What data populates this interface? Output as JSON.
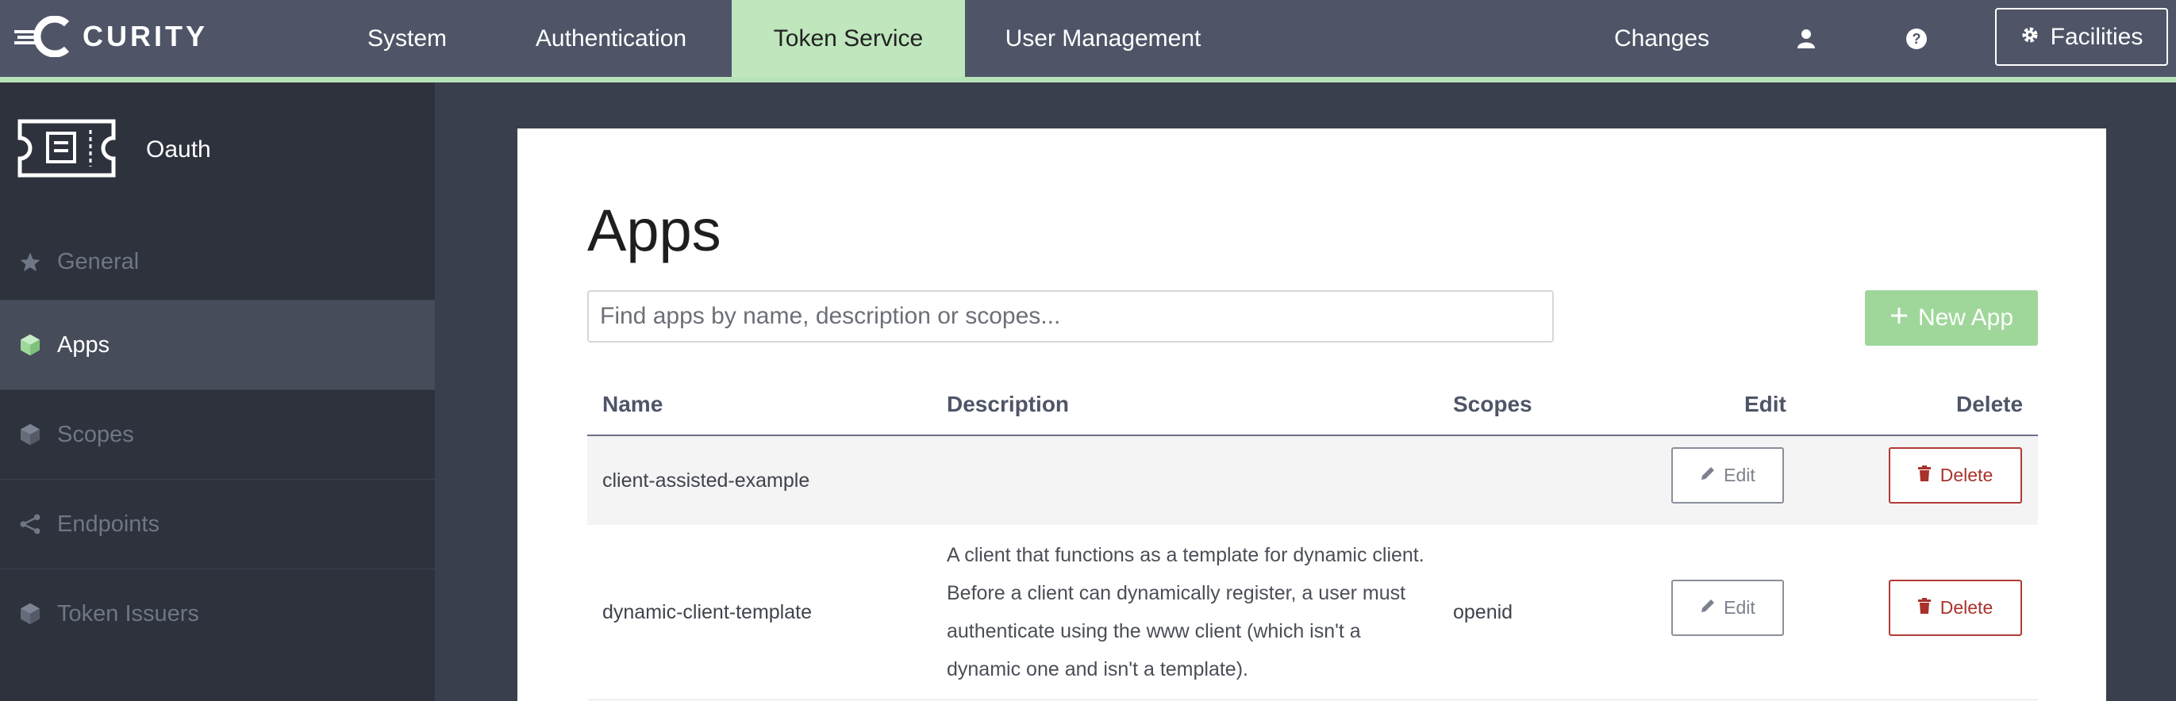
{
  "brand": {
    "name": "CURITY"
  },
  "nav": {
    "items": [
      {
        "label": "System"
      },
      {
        "label": "Authentication"
      },
      {
        "label": "Token Service"
      },
      {
        "label": "User Management"
      }
    ],
    "active": "Token Service",
    "changes_label": "Changes",
    "user_icon": "user-icon",
    "help_icon": "help-icon",
    "facilities_label": "Facilities",
    "facilities_icon": "gear-icon"
  },
  "sidebar": {
    "title": "Oauth",
    "header_icon": "ticket-icon",
    "items": [
      {
        "label": "General",
        "icon": "star-icon"
      },
      {
        "label": "Apps",
        "icon": "cube-icon"
      },
      {
        "label": "Scopes",
        "icon": "cube-icon"
      },
      {
        "label": "Endpoints",
        "icon": "share-icon"
      },
      {
        "label": "Token Issuers",
        "icon": "cube-icon"
      }
    ],
    "active": "Apps"
  },
  "main": {
    "title": "Apps",
    "search": {
      "placeholder": "Find apps by name, description or scopes...",
      "value": ""
    },
    "new_app_label": "New App",
    "table": {
      "columns": [
        "Name",
        "Description",
        "Scopes",
        "Edit",
        "Delete"
      ],
      "rows": [
        {
          "name": "client-assisted-example",
          "description": "",
          "scopes": "",
          "edit": "Edit",
          "delete": "Delete"
        },
        {
          "name": "dynamic-client-template",
          "description": "A client that functions as a template for dynamic client. Before a client can dynamically register, a user must authenticate using the www client (which isn't a dynamic one and isn't a template).",
          "scopes": "openid",
          "edit": "Edit",
          "delete": "Delete"
        }
      ]
    }
  },
  "colors": {
    "topbar": "#4f5567",
    "accent_green": "#bfe6bd",
    "new_app_button": "#9fd79a",
    "delete_red": "#b13b35",
    "sidebar": "#2e323d"
  }
}
